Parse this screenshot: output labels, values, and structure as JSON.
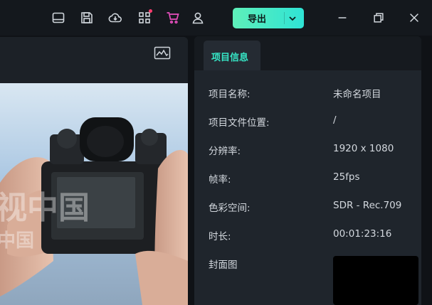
{
  "toolbar": {
    "icons": [
      "layout-icon",
      "save-icon",
      "cloud-sync-icon",
      "apps-grid-icon",
      "cart-icon",
      "user-icon"
    ],
    "export_label": "导出"
  },
  "window_controls": [
    "minimize-icon",
    "restore-icon",
    "close-icon"
  ],
  "preview": {
    "watermark_text_1": "视中国",
    "watermark_text_2": "中国"
  },
  "info_panel": {
    "tab_label": "项目信息",
    "rows": [
      {
        "label": "项目名称:",
        "value": "未命名项目"
      },
      {
        "label": "项目文件位置:",
        "value": "/"
      },
      {
        "label": "分辨率:",
        "value": "1920 x 1080"
      },
      {
        "label": "帧率:",
        "value": "25fps"
      },
      {
        "label": "色彩空间:",
        "value": "SDR - Rec.709"
      },
      {
        "label": "时长:",
        "value": "00:01:23:16"
      },
      {
        "label": "封面图",
        "value": ""
      }
    ]
  },
  "colors": {
    "accent": "#36e6c6",
    "export_gradient_start": "#5ef0b9",
    "export_gradient_end": "#2fe3d5",
    "notification_dot": "#ff3c6e",
    "cart_icon": "#e84fbf"
  }
}
